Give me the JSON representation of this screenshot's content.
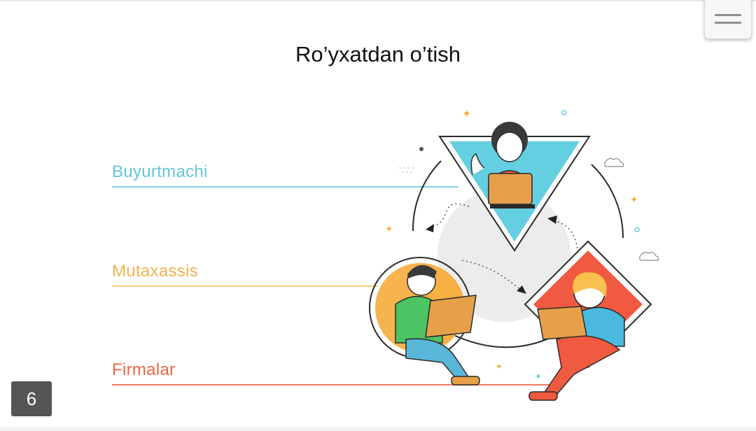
{
  "title": "Ro’yxatdan o’tish",
  "roles": [
    {
      "label": "Buyurtmachi",
      "color": "#63c6dc"
    },
    {
      "label": "Mutaxassis",
      "color": "#f2b24f"
    },
    {
      "label": "Firmalar",
      "color": "#ea6547"
    }
  ],
  "page_number": "6",
  "icons": {
    "menu": "hamburger-menu-icon",
    "illustration": "three-users-with-laptops-illustration"
  },
  "colors": {
    "triangle": "#63cfe0",
    "circle": "#f7b045",
    "diamond": "#f05a40",
    "hub": "#ececec"
  }
}
